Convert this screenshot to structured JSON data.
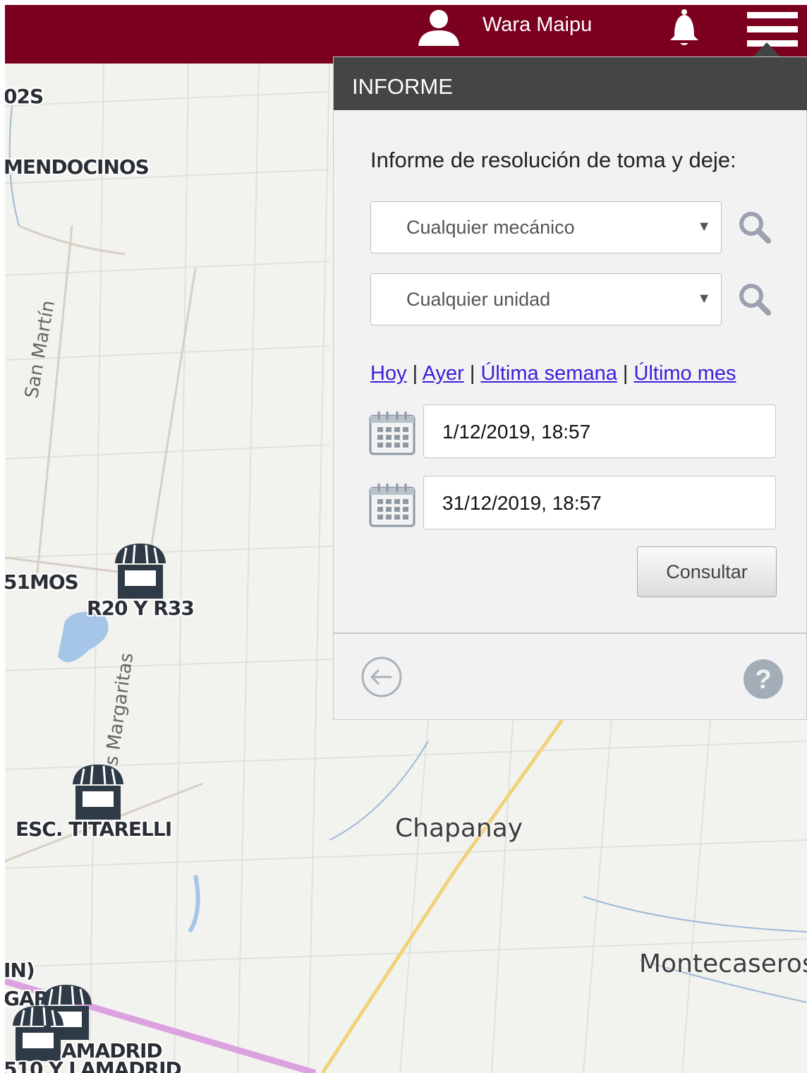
{
  "header": {
    "user_name": "Wara Maipu",
    "colors": {
      "bar": "#7b0020"
    },
    "icons": [
      "user-icon",
      "bell-icon",
      "hamburger-menu-icon"
    ]
  },
  "map": {
    "markers": [
      {
        "label": "R20 Y R33"
      },
      {
        "label": "ESC. TITARELLI"
      }
    ],
    "partial_labels": [
      "02S",
      "MENDOCINOS",
      "51MOS",
      "IN)",
      "GAR",
      "AMADRID",
      "510 Y LAMADRID"
    ],
    "towns": [
      "Chapanay",
      "Montecaseros"
    ],
    "streets": [
      "San Martín",
      "s Margaritas"
    ]
  },
  "panel": {
    "title": "INFORME",
    "report_title": "Informe de resolución de toma y deje:",
    "mechanic_select": {
      "value": "Cualquier mecánico"
    },
    "unit_select": {
      "value": "Cualquier unidad"
    },
    "quick_links": {
      "today": "Hoy",
      "yesterday": "Ayer",
      "last_week": "Última semana",
      "last_month": "Último mes",
      "separator": "|"
    },
    "date_from": "1/12/2019, 18:57",
    "date_to": "31/12/2019, 18:57",
    "submit_label": "Consultar",
    "footer_icons": [
      "back-arrow-icon",
      "help-icon"
    ]
  }
}
